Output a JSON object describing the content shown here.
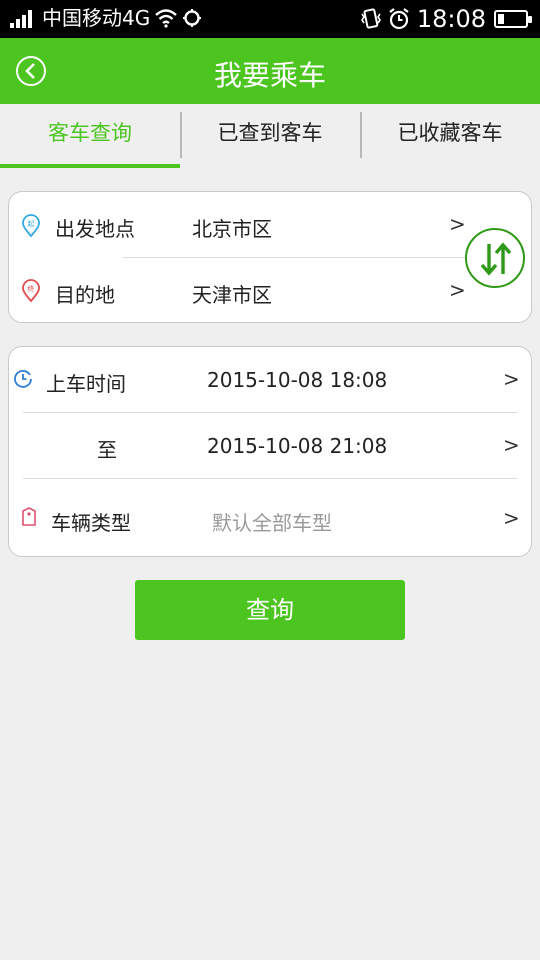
{
  "status_bar": {
    "carrier": "中国移动4G",
    "time": "18:08"
  },
  "header": {
    "title": "我要乘车"
  },
  "tabs": [
    {
      "label": "客车查询",
      "active": true
    },
    {
      "label": "已查到客车",
      "active": false
    },
    {
      "label": "已收藏客车",
      "active": false
    }
  ],
  "route": {
    "departure_label": "出发地点",
    "departure_value": "北京市区",
    "destination_label": "目的地",
    "destination_value": "天津市区"
  },
  "filters": {
    "time_label": "上车时间",
    "time_from": "2015-10-08 18:08",
    "to_label": "至",
    "time_to": "2015-10-08 21:08",
    "type_label": "车辆类型",
    "type_placeholder": "默认全部车型"
  },
  "query_button": "查询",
  "colors": {
    "accent": "#4cc521",
    "swap_border": "#2f9a17",
    "start_icon": "#35a9e3",
    "end_icon": "#e24b4b"
  }
}
